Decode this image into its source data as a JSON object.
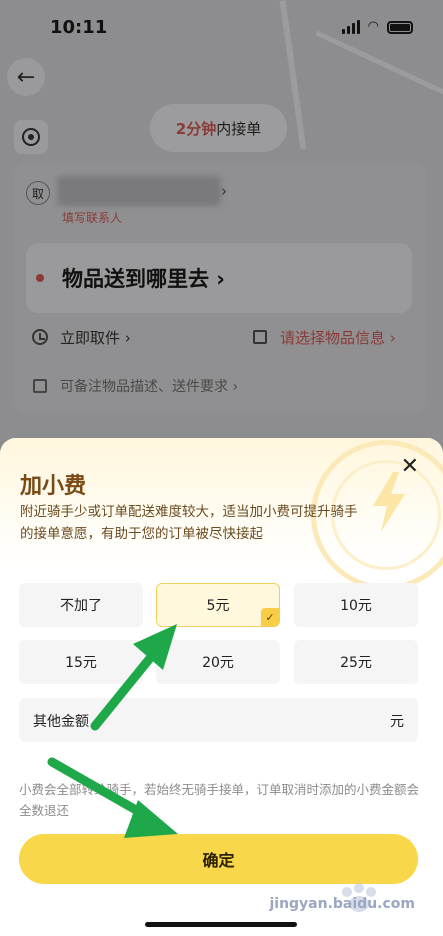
{
  "status_bar": {
    "time": "10:11"
  },
  "background": {
    "eta": {
      "highlight": "2分钟",
      "suffix": "内接单"
    },
    "pickup_tag": "取",
    "fill_contact": "填写联系人",
    "destination": "物品送到哪里去",
    "pickup_time": "立即取件",
    "item_info": "请选择物品信息",
    "remark": "可备注物品描述、送件要求"
  },
  "sheet": {
    "title": "加小费",
    "description": "附近骑手少或订单配送难度较大，适当加小费可提升骑手的接单意愿，有助于您的订单被尽快接起",
    "options": [
      {
        "label": "不加了",
        "selected": false
      },
      {
        "label": "5元",
        "selected": true
      },
      {
        "label": "10元",
        "selected": false
      },
      {
        "label": "15元",
        "selected": false
      },
      {
        "label": "20元",
        "selected": false
      },
      {
        "label": "25元",
        "selected": false
      }
    ],
    "other_amount": {
      "label": "其他金额",
      "unit": "元"
    },
    "note": "小费会全部转给骑手，若始终无骑手接单，订单取消时添加的小费金额会全数退还",
    "confirm_label": "确定"
  },
  "watermark": "jingyan.baidu.com",
  "colors": {
    "accent": "#f8d84a",
    "title": "#7a4a14",
    "arrow": "#1fa84a",
    "highlight": "#8a3b37"
  }
}
